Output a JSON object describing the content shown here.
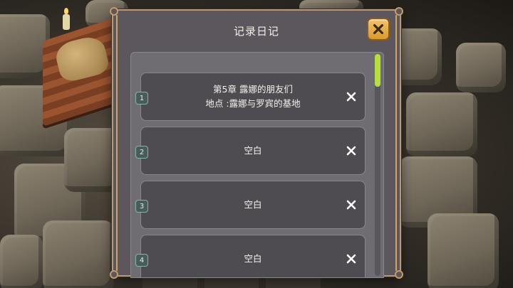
{
  "dialog": {
    "title": "记录日记",
    "close_icon": "close-x-icon"
  },
  "colors": {
    "panel": "#5c575d",
    "frame": "#b79877",
    "close_button": "#e8ae45",
    "scrollbar_thumb": "#b7e03a",
    "slot_number_border": "#7fb5aa"
  },
  "scroll": {
    "position_fraction": 0.0
  },
  "slots": [
    {
      "number": "1",
      "line1": "第5章 露娜的朋友们",
      "line2": "地点 :露娜与罗宾的基地",
      "delete_icon": "delete-x-icon"
    },
    {
      "number": "2",
      "line1": "空白",
      "line2": "",
      "delete_icon": "delete-x-icon"
    },
    {
      "number": "3",
      "line1": "空白",
      "line2": "",
      "delete_icon": "delete-x-icon"
    },
    {
      "number": "4",
      "line1": "空白",
      "line2": "",
      "delete_icon": "delete-x-icon"
    }
  ]
}
